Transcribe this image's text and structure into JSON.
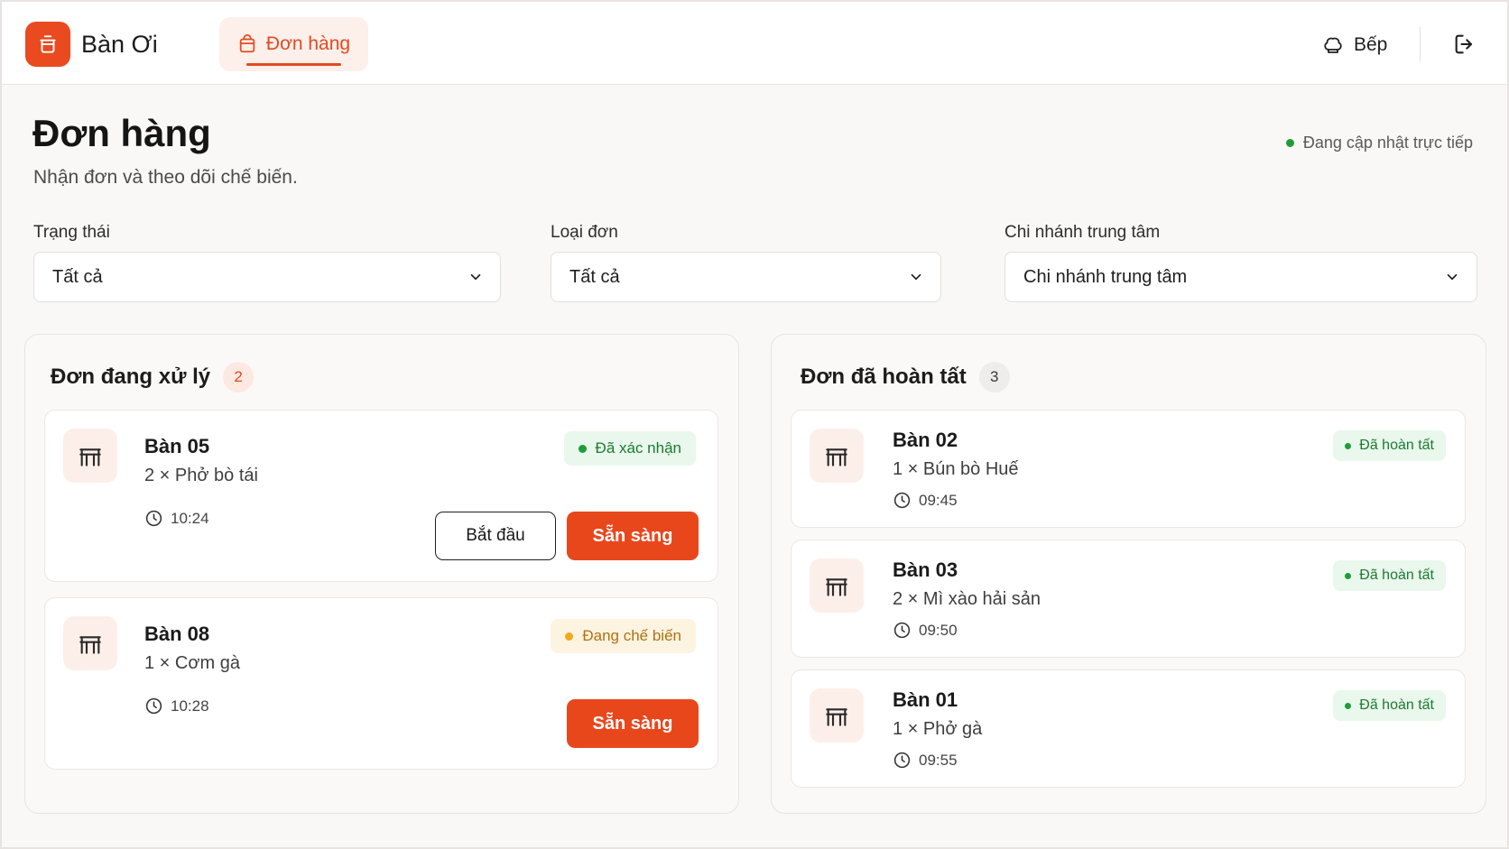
{
  "colors": {
    "accent": "#e8471c",
    "accent_soft": "#fdefe9",
    "success": "#1f9d3a",
    "success_bg": "#e9f7ec",
    "warning": "#f2a91a",
    "warning_bg": "#fdf3e1"
  },
  "topbar": {
    "brand": "Bàn Ơi",
    "logo_icon": "pot-icon",
    "nav_tab": {
      "label": "Đơn hàng",
      "icon": "shopping-bag-icon"
    },
    "kitchen_label": "Bếp",
    "kitchen_icon": "chef-hat-icon",
    "logout_icon": "logout-icon"
  },
  "header": {
    "title": "Đơn hàng",
    "subtitle": "Nhận đơn và theo dõi chế biến.",
    "live_status": "Đang cập nhật trực tiếp"
  },
  "filters": {
    "status": {
      "label": "Trạng thái",
      "value": "Tất cả"
    },
    "order_type": {
      "label": "Loại đơn",
      "value": "Tất cả"
    },
    "branch": {
      "label": "Chi nhánh trung tâm",
      "value": "Chi nhánh trung tâm"
    }
  },
  "processing": {
    "title": "Đơn đang xử lý",
    "count": "2",
    "orders": [
      {
        "table": "Bàn 05",
        "item": "2 × Phở bò tái",
        "time": "10:24",
        "status": "Đã xác nhận",
        "start_label": "Bắt đầu",
        "ready_label": "Sẵn sàng"
      },
      {
        "table": "Bàn 08",
        "item": "1 × Cơm gà",
        "time": "10:28",
        "status": "Đang chế biến",
        "ready_label": "Sẵn sàng"
      }
    ]
  },
  "completed": {
    "title": "Đơn đã hoàn tất",
    "count": "3",
    "orders": [
      {
        "table": "Bàn 02",
        "item": "1 × Bún bò Huế",
        "time": "09:45",
        "status": "Đã hoàn tất"
      },
      {
        "table": "Bàn 03",
        "item": "2 × Mì xào hải sản",
        "time": "09:50",
        "status": "Đã hoàn tất"
      },
      {
        "table": "Bàn 01",
        "item": "1 × Phở gà",
        "time": "09:55",
        "status": "Đã hoàn tất"
      }
    ]
  }
}
